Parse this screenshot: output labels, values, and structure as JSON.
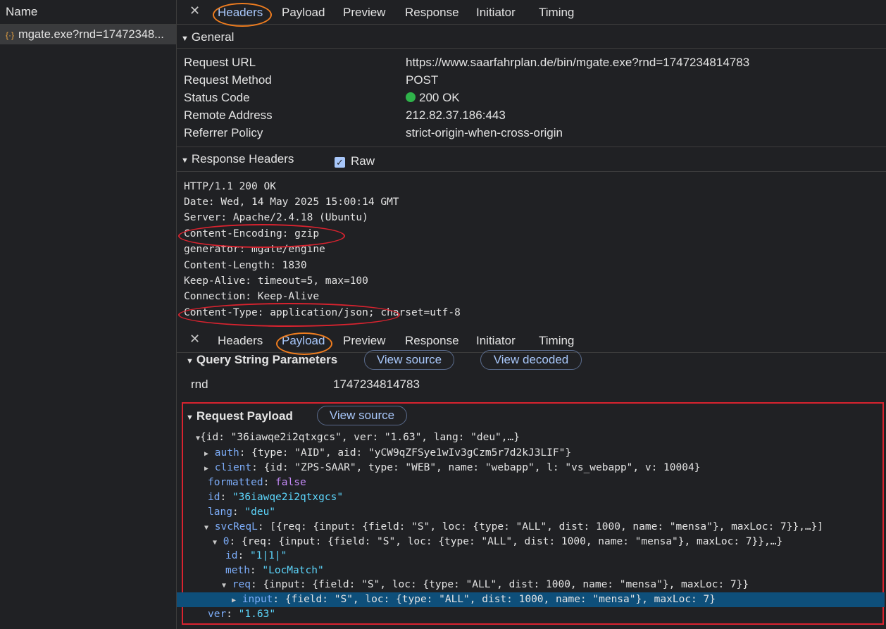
{
  "left_panel": {
    "header": "Name",
    "request_name": "mgate.exe?rnd=17472348..."
  },
  "tabs_top": [
    "Headers",
    "Payload",
    "Preview",
    "Response",
    "Initiator",
    "Timing"
  ],
  "tabs_mid": [
    "Headers",
    "Payload",
    "Preview",
    "Response",
    "Initiator",
    "Timing"
  ],
  "general": {
    "title": "General",
    "rows": [
      {
        "k": "Request URL",
        "v": "https://www.saarfahrplan.de/bin/mgate.exe?rnd=1747234814783"
      },
      {
        "k": "Request Method",
        "v": "POST"
      },
      {
        "k": "Status Code",
        "v": "200 OK"
      },
      {
        "k": "Remote Address",
        "v": "212.82.37.186:443"
      },
      {
        "k": "Referrer Policy",
        "v": "strict-origin-when-cross-origin"
      }
    ]
  },
  "response_headers": {
    "title": "Response Headers",
    "raw_label": "Raw",
    "lines": [
      "HTTP/1.1 200 OK",
      "Date: Wed, 14 May 2025 15:00:14 GMT",
      "Server: Apache/2.4.18 (Ubuntu)",
      "Content-Encoding: gzip",
      "generator: mgate/engine",
      "Content-Length: 1830",
      "Keep-Alive: timeout=5, max=100",
      "Connection: Keep-Alive",
      "Content-Type: application/json; charset=utf-8"
    ]
  },
  "query": {
    "title": "Query String Parameters",
    "view_source": "View source",
    "view_decoded": "View decoded",
    "param_key": "rnd",
    "param_val": "1747234814783"
  },
  "payload": {
    "title": "Request Payload",
    "view_source": "View source",
    "lines": {
      "root": "{id: \"36iawqe2i2qtxgcs\", ver: \"1.63\", lang: \"deu\",…}",
      "auth_k": "auth",
      "auth_v": "{type: \"AID\", aid: \"yCW9qZFSye1wIv3gCzm5r7d2kJ3LIF\"}",
      "client_k": "client",
      "client_v": "{id: \"ZPS-SAAR\", type: \"WEB\", name: \"webapp\", l: \"vs_webapp\", v: 10004}",
      "formatted_k": "formatted",
      "formatted_v": "false",
      "id_k": "id",
      "id_v": "\"36iawqe2i2qtxgcs\"",
      "lang_k": "lang",
      "lang_v": "\"deu\"",
      "svc_k": "svcReqL",
      "svc_v": "[{req: {input: {field: \"S\", loc: {type: \"ALL\", dist: 1000, name: \"mensa\"}, maxLoc: 7}},…}]",
      "zero_k": "0",
      "zero_v": "{req: {input: {field: \"S\", loc: {type: \"ALL\", dist: 1000, name: \"mensa\"}, maxLoc: 7}},…}",
      "id2_k": "id",
      "id2_v": "\"1|1|\"",
      "meth_k": "meth",
      "meth_v": "\"LocMatch\"",
      "req_k": "req",
      "req_v": "{input: {field: \"S\", loc: {type: \"ALL\", dist: 1000, name: \"mensa\"}, maxLoc: 7}}",
      "input_k": "input",
      "input_v": "{field: \"S\", loc: {type: \"ALL\", dist: 1000, name: \"mensa\"}, maxLoc: 7}",
      "ver_k": "ver",
      "ver_v": "\"1.63\""
    }
  },
  "colors": {
    "accent": "#a8c7fa",
    "highlight": "#0e4f7a",
    "annotation_orange": "#ef7d1f",
    "annotation_red": "#d9232f",
    "status_green": "#2fb34a"
  }
}
